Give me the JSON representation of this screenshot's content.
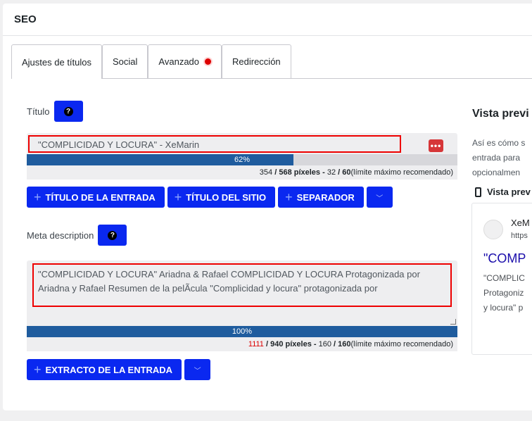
{
  "panel": {
    "title": "SEO"
  },
  "tabs": [
    {
      "label": "Ajustes de títulos",
      "active": true
    },
    {
      "label": "Social",
      "active": false
    },
    {
      "label": "Avanzado",
      "active": false,
      "alert": true
    },
    {
      "label": "Redirección",
      "active": false
    }
  ],
  "title_field": {
    "label": "Título",
    "help_icon": "question-icon",
    "value": "\"COMPLICIDAD Y LOCURA\" - XeMarin",
    "menu_icon": "ellipsis-icon",
    "progress_percent": 62,
    "progress_label": "62%",
    "chars": "354",
    "pixels": "/ 568 píxeles -",
    "count": "32",
    "max": "/ 60",
    "note": "(límite máximo recomendado)",
    "buttons": [
      {
        "label": "TÍTULO DE LA ENTRADA"
      },
      {
        "label": "TÍTULO DEL SITIO"
      },
      {
        "label": "SEPARADOR"
      }
    ]
  },
  "description_field": {
    "label": "Meta description",
    "help_icon": "question-icon",
    "value": "\"COMPLICIDAD Y LOCURA\" Ariadna & Rafael COMPLICIDAD Y LOCURA Protagonizada por Ariadna y Rafael Resumen de la pelÃcula \"Complicidad y locura\" protagonizada por",
    "progress_percent": 100,
    "progress_label": "100%",
    "chars": "1111",
    "pixels": "/ 940 píxeles -",
    "count": "160",
    "max": "/ 160",
    "note": "(límite máximo recomendado)",
    "buttons": [
      {
        "label": "EXTRACTO DE LA ENTRADA"
      }
    ]
  },
  "preview": {
    "title": "Vista previ",
    "desc_lines": [
      "Así es cómo s",
      "entrada para",
      "opcionalmen"
    ],
    "mode_label": "Vista prev",
    "mode_icon": "mobile-icon",
    "serp": {
      "site_name": "XeM",
      "site_url": "https",
      "title": "\"COMP",
      "desc_lines": [
        "\"COMPLIC",
        "Protagoniz",
        "y locura\" p"
      ]
    }
  },
  "colors": {
    "primary": "#0a28f0",
    "progress": "#1f5c9e",
    "alert": "#d00000",
    "highlight": "#e00000"
  }
}
